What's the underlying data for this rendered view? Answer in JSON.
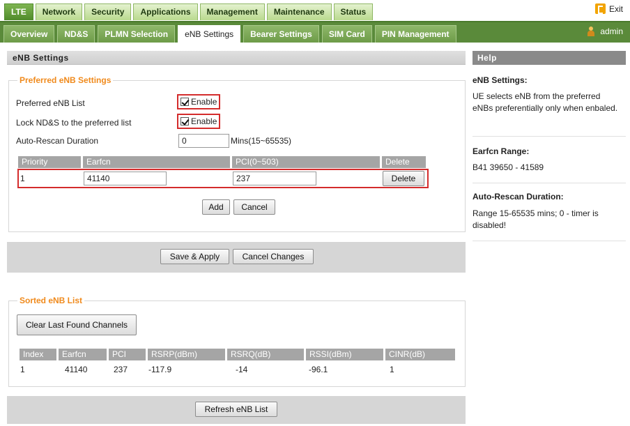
{
  "top_tabs": [
    {
      "label": "LTE"
    },
    {
      "label": "Network"
    },
    {
      "label": "Security"
    },
    {
      "label": "Applications"
    },
    {
      "label": "Management"
    },
    {
      "label": "Maintenance"
    },
    {
      "label": "Status"
    }
  ],
  "active_top_tab": "LTE",
  "exit_label": "Exit",
  "sub_tabs": [
    {
      "label": "Overview"
    },
    {
      "label": "ND&S"
    },
    {
      "label": "PLMN Selection"
    },
    {
      "label": "eNB Settings"
    },
    {
      "label": "Bearer Settings"
    },
    {
      "label": "SIM Card"
    },
    {
      "label": "PIN Management"
    }
  ],
  "active_sub_tab": "eNB Settings",
  "user_label": "admin",
  "page_title": "eNB Settings",
  "preferred": {
    "legend": "Preferred eNB Settings",
    "list_label": "Preferred eNB List",
    "list_enable": "Enable",
    "lock_label": "Lock ND&S to the preferred list",
    "lock_enable": "Enable",
    "rescan_label": "Auto-Rescan Duration",
    "rescan_value": "0",
    "rescan_unit": "Mins(15~65535)",
    "columns": [
      "Priority",
      "Earfcn",
      "PCI(0~503)",
      "Delete"
    ],
    "rows": [
      {
        "priority": "1",
        "earfcn": "41140",
        "pci": "237",
        "delete": "Delete"
      }
    ],
    "add_button": "Add",
    "cancel_button": "Cancel"
  },
  "save_apply_button": "Save & Apply",
  "cancel_changes_button": "Cancel Changes",
  "sorted": {
    "legend": "Sorted eNB List",
    "clear_button": "Clear Last Found Channels",
    "columns": [
      "Index",
      "Earfcn",
      "PCI",
      "RSRP(dBm)",
      "RSRQ(dB)",
      "RSSI(dBm)",
      "CINR(dB)"
    ],
    "rows": [
      {
        "index": "1",
        "earfcn": "41140",
        "pci": "237",
        "rsrp": "-117.9",
        "rsrq": "-14",
        "rssi": "-96.1",
        "cinr": "1"
      }
    ]
  },
  "refresh_button": "Refresh eNB List",
  "help": {
    "header": "Help",
    "items": [
      {
        "title": "eNB Settings:",
        "text": "UE selects eNB from the preferred eNBs preferentially only when enbaled."
      },
      {
        "title": "Earfcn Range:",
        "text": "B41 39650 - 41589"
      },
      {
        "title": "Auto-Rescan Duration:",
        "text": "Range 15-65535 mins; 0 - timer is disabled!"
      }
    ]
  }
}
